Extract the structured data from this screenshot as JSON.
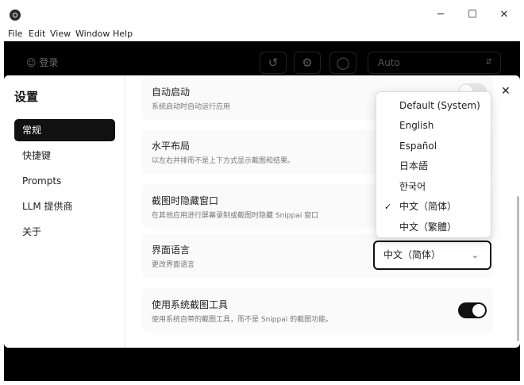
{
  "window": {
    "minimize_glyph": "─",
    "maximize_glyph": "☐",
    "close_glyph": "✕"
  },
  "menu": [
    "File",
    "Edit",
    "View",
    "Window",
    "Help"
  ],
  "background_app": {
    "login_label": "登录",
    "history_icon": "history-icon",
    "settings_icon": "gear-icon",
    "language_icon": "globe-icon",
    "mode_select_value": "Auto"
  },
  "dialog": {
    "title": "设置",
    "close_glyph": "✕",
    "nav": [
      {
        "label": "常规",
        "active": true
      },
      {
        "label": "快捷键",
        "active": false
      },
      {
        "label": "Prompts",
        "active": false
      },
      {
        "label": "LLM 提供商",
        "active": false
      },
      {
        "label": "关于",
        "active": false
      }
    ],
    "settings": [
      {
        "title": "自动启动",
        "desc": "系统启动时自动运行应用",
        "toggle": false
      },
      {
        "title": "水平布局",
        "desc": "以左右并排而不是上下方式显示截图和结果。"
      },
      {
        "title": "截图时隐藏窗口",
        "desc": "在其他应用进行屏幕录制或截图时隐藏 Snippai 窗口"
      },
      {
        "title": "界面语言",
        "desc": "更改界面语言",
        "select_value": "中文（简体）"
      },
      {
        "title": "使用系统截图工具",
        "desc": "使用系统自带的截图工具，而不是 Snippai 的截图功能。",
        "toggle": true
      }
    ]
  },
  "language_dropdown": {
    "selected_index": 5,
    "check_glyph": "✓",
    "options": [
      "Default (System)",
      "English",
      "Español",
      "日本語",
      "한국어",
      "中文（简体）",
      "中文（繁體）"
    ]
  },
  "colors": {
    "accent": "#111111",
    "background_app": "#000000"
  }
}
